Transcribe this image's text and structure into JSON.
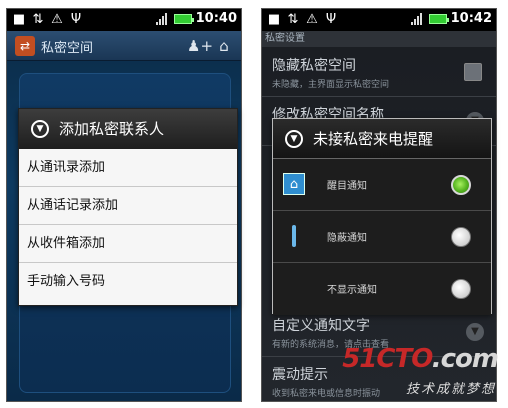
{
  "status_bar": {
    "left_time": "10:40",
    "right_time": "10:42"
  },
  "left_screen": {
    "app_title": "私密空间",
    "dialog": {
      "title": "添加私密联系人",
      "items": [
        {
          "label": "从通讯录添加"
        },
        {
          "label": "从通话记录添加"
        },
        {
          "label": "从收件箱添加"
        },
        {
          "label": "手动输入号码"
        }
      ]
    }
  },
  "right_screen": {
    "header": "私密设置",
    "settings": [
      {
        "title": "隐藏私密空间",
        "subtitle": "未隐藏，主界面显示私密空间"
      },
      {
        "title": "修改私密空间名称",
        "subtitle": ""
      },
      {
        "title": "自定义通知文字",
        "subtitle": "有新的系统消息，请点击查看"
      },
      {
        "title": "震动提示",
        "subtitle": "收到私密来电或信息时振动"
      }
    ],
    "dialog": {
      "title": "未接私密来电提醒",
      "options": [
        {
          "label": "醒目通知",
          "selected": true
        },
        {
          "label": "隐蔽通知",
          "selected": false
        },
        {
          "label": "不显示通知",
          "selected": false
        }
      ]
    }
  },
  "watermark": {
    "main": "51CTO",
    "suffix": ".com",
    "sub": "技术成就梦想"
  }
}
